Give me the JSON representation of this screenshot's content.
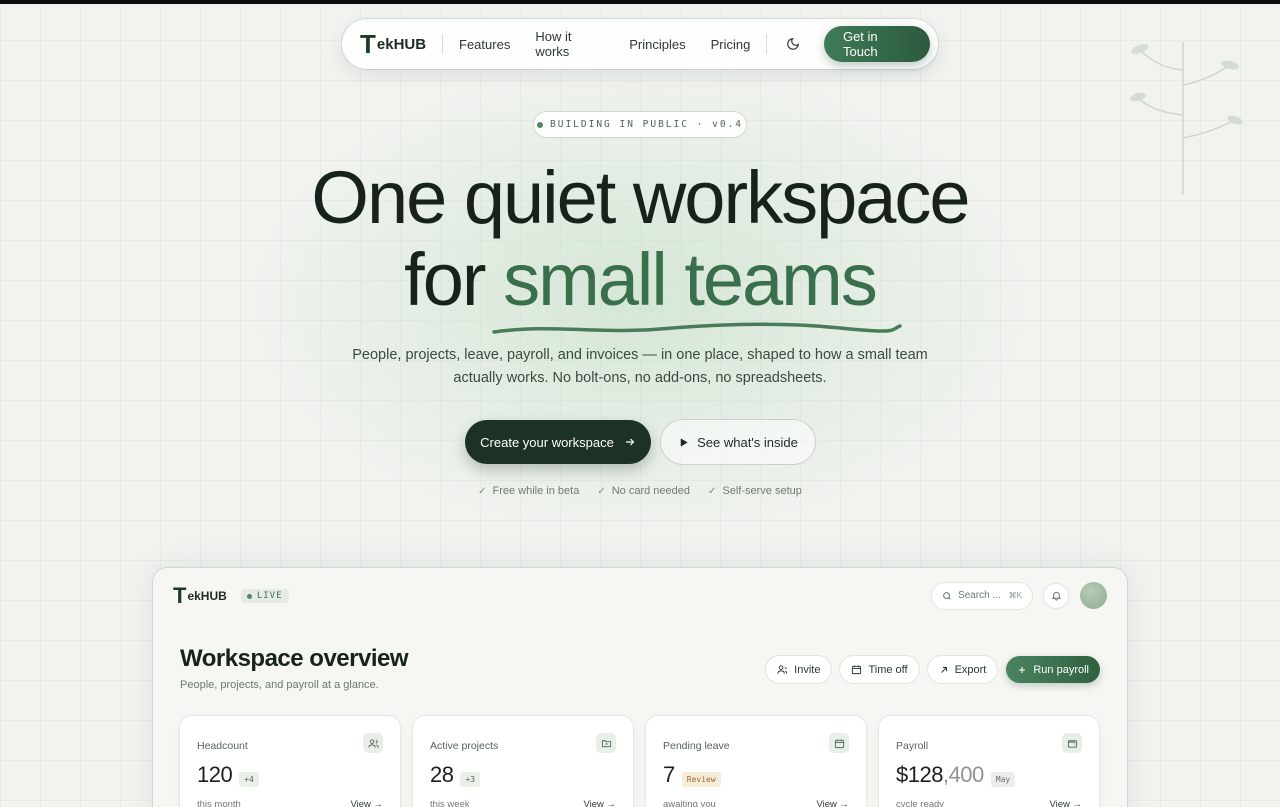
{
  "brand": {
    "logo_mark": "T",
    "logo_text": "ekHUB"
  },
  "nav": {
    "links": [
      "Features",
      "How it works",
      "Principles",
      "Pricing"
    ],
    "theme_icon": "moon-icon",
    "cta": "Get in Touch"
  },
  "hero": {
    "badge": "BUILDING IN PUBLIC · v0.4",
    "title_line1": "One quiet workspace",
    "title_line2_prefix": "for ",
    "title_line2_accent": "small teams",
    "subtitle": "People, projects, leave, payroll, and invoices — in one place, shaped to how a small team actually works. No bolt-ons, no add-ons, no spreadsheets.",
    "primary_cta": "Create your workspace",
    "secondary_cta": "See what's inside",
    "perks": [
      "Free while in beta",
      "No card needed",
      "Self-serve setup"
    ]
  },
  "dashboard": {
    "logo_mark": "T",
    "logo_text": "ekHUB",
    "live_label": "LIVE",
    "search_placeholder": "Search ...",
    "search_shortcut": "⌘K",
    "title": "Workspace overview",
    "subtitle": "People, projects, and payroll at a glance.",
    "actions": [
      "Invite",
      "Time off",
      "Export",
      "Run payroll"
    ],
    "cards": [
      {
        "label": "Headcount",
        "value": "120",
        "value_muted": "",
        "tag": "+4",
        "foot": "this month",
        "link": "View →",
        "icon": "users-icon"
      },
      {
        "label": "Active projects",
        "value": "28",
        "value_muted": "",
        "tag": "+3",
        "foot": "this week",
        "link": "View →",
        "icon": "folder-icon"
      },
      {
        "label": "Pending leave",
        "value": "7",
        "value_muted": "",
        "tag": "Review",
        "foot": "awaiting you",
        "link": "View →",
        "icon": "calendar-icon"
      },
      {
        "label": "Payroll",
        "value": "$128",
        "value_muted": ",400",
        "tag": "May",
        "foot": "cycle ready",
        "link": "View →",
        "icon": "wallet-icon"
      }
    ]
  },
  "colors": {
    "accent": "#3a6f4c",
    "dark": "#1c3224",
    "background": "#f1f3ef"
  }
}
